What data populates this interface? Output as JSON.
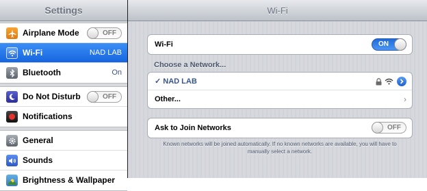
{
  "sidebar": {
    "title": "Settings",
    "items": [
      {
        "label": "Airplane Mode",
        "icon": "airplane-icon",
        "toggle": "OFF"
      },
      {
        "label": "Wi-Fi",
        "icon": "wifi-icon",
        "value": "NAD LAB",
        "selected": true
      },
      {
        "label": "Bluetooth",
        "icon": "bluetooth-icon",
        "value": "On"
      },
      {
        "label": "Do Not Disturb",
        "icon": "moon-icon",
        "toggle": "OFF"
      },
      {
        "label": "Notifications",
        "icon": "notifications-icon"
      },
      {
        "label": "General",
        "icon": "gear-icon"
      },
      {
        "label": "Sounds",
        "icon": "speaker-icon"
      },
      {
        "label": "Brightness & Wallpaper",
        "icon": "brightness-icon"
      }
    ]
  },
  "detail": {
    "title": "Wi-Fi",
    "wifi_row": {
      "label": "Wi-Fi",
      "toggle": "ON"
    },
    "choose_header": "Choose a Network...",
    "networks": [
      {
        "label": "✓ NAD LAB",
        "secured": true,
        "connected": true
      }
    ],
    "other_label": "Other...",
    "ask_row": {
      "label": "Ask to Join Networks",
      "toggle": "OFF"
    },
    "footnote": "Known networks will be joined automatically. If no known networks are available, you will have to manually select a network."
  },
  "colors": {
    "selection_blue": "#1f6fe6",
    "switch_on_blue": "#2f7de9",
    "network_text": "#385487"
  }
}
